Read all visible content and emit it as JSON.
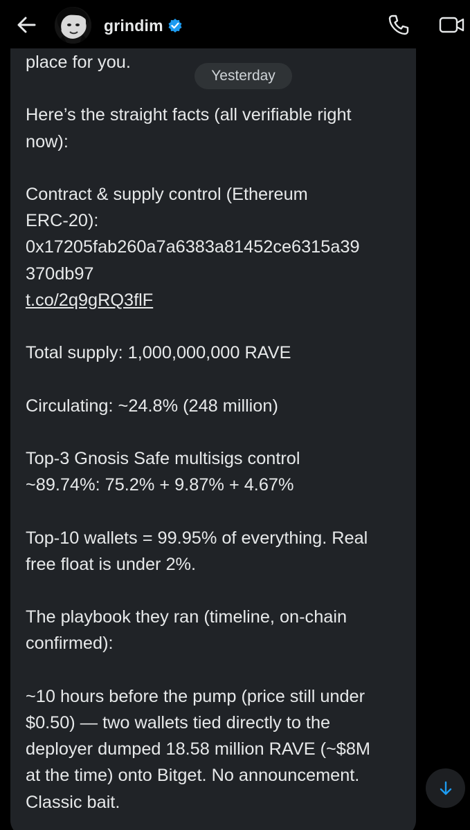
{
  "header": {
    "username": "grindim",
    "icons": {
      "back": "back-arrow-icon",
      "verified": "verified-badge-icon",
      "call": "phone-call-icon",
      "video": "video-call-icon"
    },
    "colors": {
      "verified": "#1d9bf0",
      "background": "#000000"
    }
  },
  "conversation": {
    "date_divider": "Yesterday",
    "message_lines": [
      "place for you.",
      "",
      "Here’s the straight facts (all verifiable right",
      "now):",
      "",
      "Contract & supply control (Ethereum",
      "ERC-20):",
      "0x17205fab260a7a6383a81452ce6315a39",
      "370db97",
      "t.co/2q9gRQ3flF",
      "",
      "Total supply: 1,000,000,000 RAVE",
      "",
      "Circulating: ~24.8% (248 million)",
      "",
      "Top-3 Gnosis Safe multisigs control",
      "~89.74%: 75.2% + 9.87% + 4.67%",
      "",
      "Top-10 wallets = 99.95% of everything. Real",
      "free float is under 2%.",
      "",
      "The playbook they ran (timeline, on-chain",
      "confirmed):",
      "",
      "~10 hours before the pump (price still under",
      "$0.50) — two wallets tied directly to the",
      "deployer dumped 18.58 million RAVE (~$8M",
      "at the time) onto Bitget. No announcement.",
      "Classic bait."
    ],
    "link_line_index": 9,
    "bubble_color": "#202327"
  },
  "scroll_button": {
    "icon": "arrow-down-icon",
    "color": "#1d9bf0"
  }
}
